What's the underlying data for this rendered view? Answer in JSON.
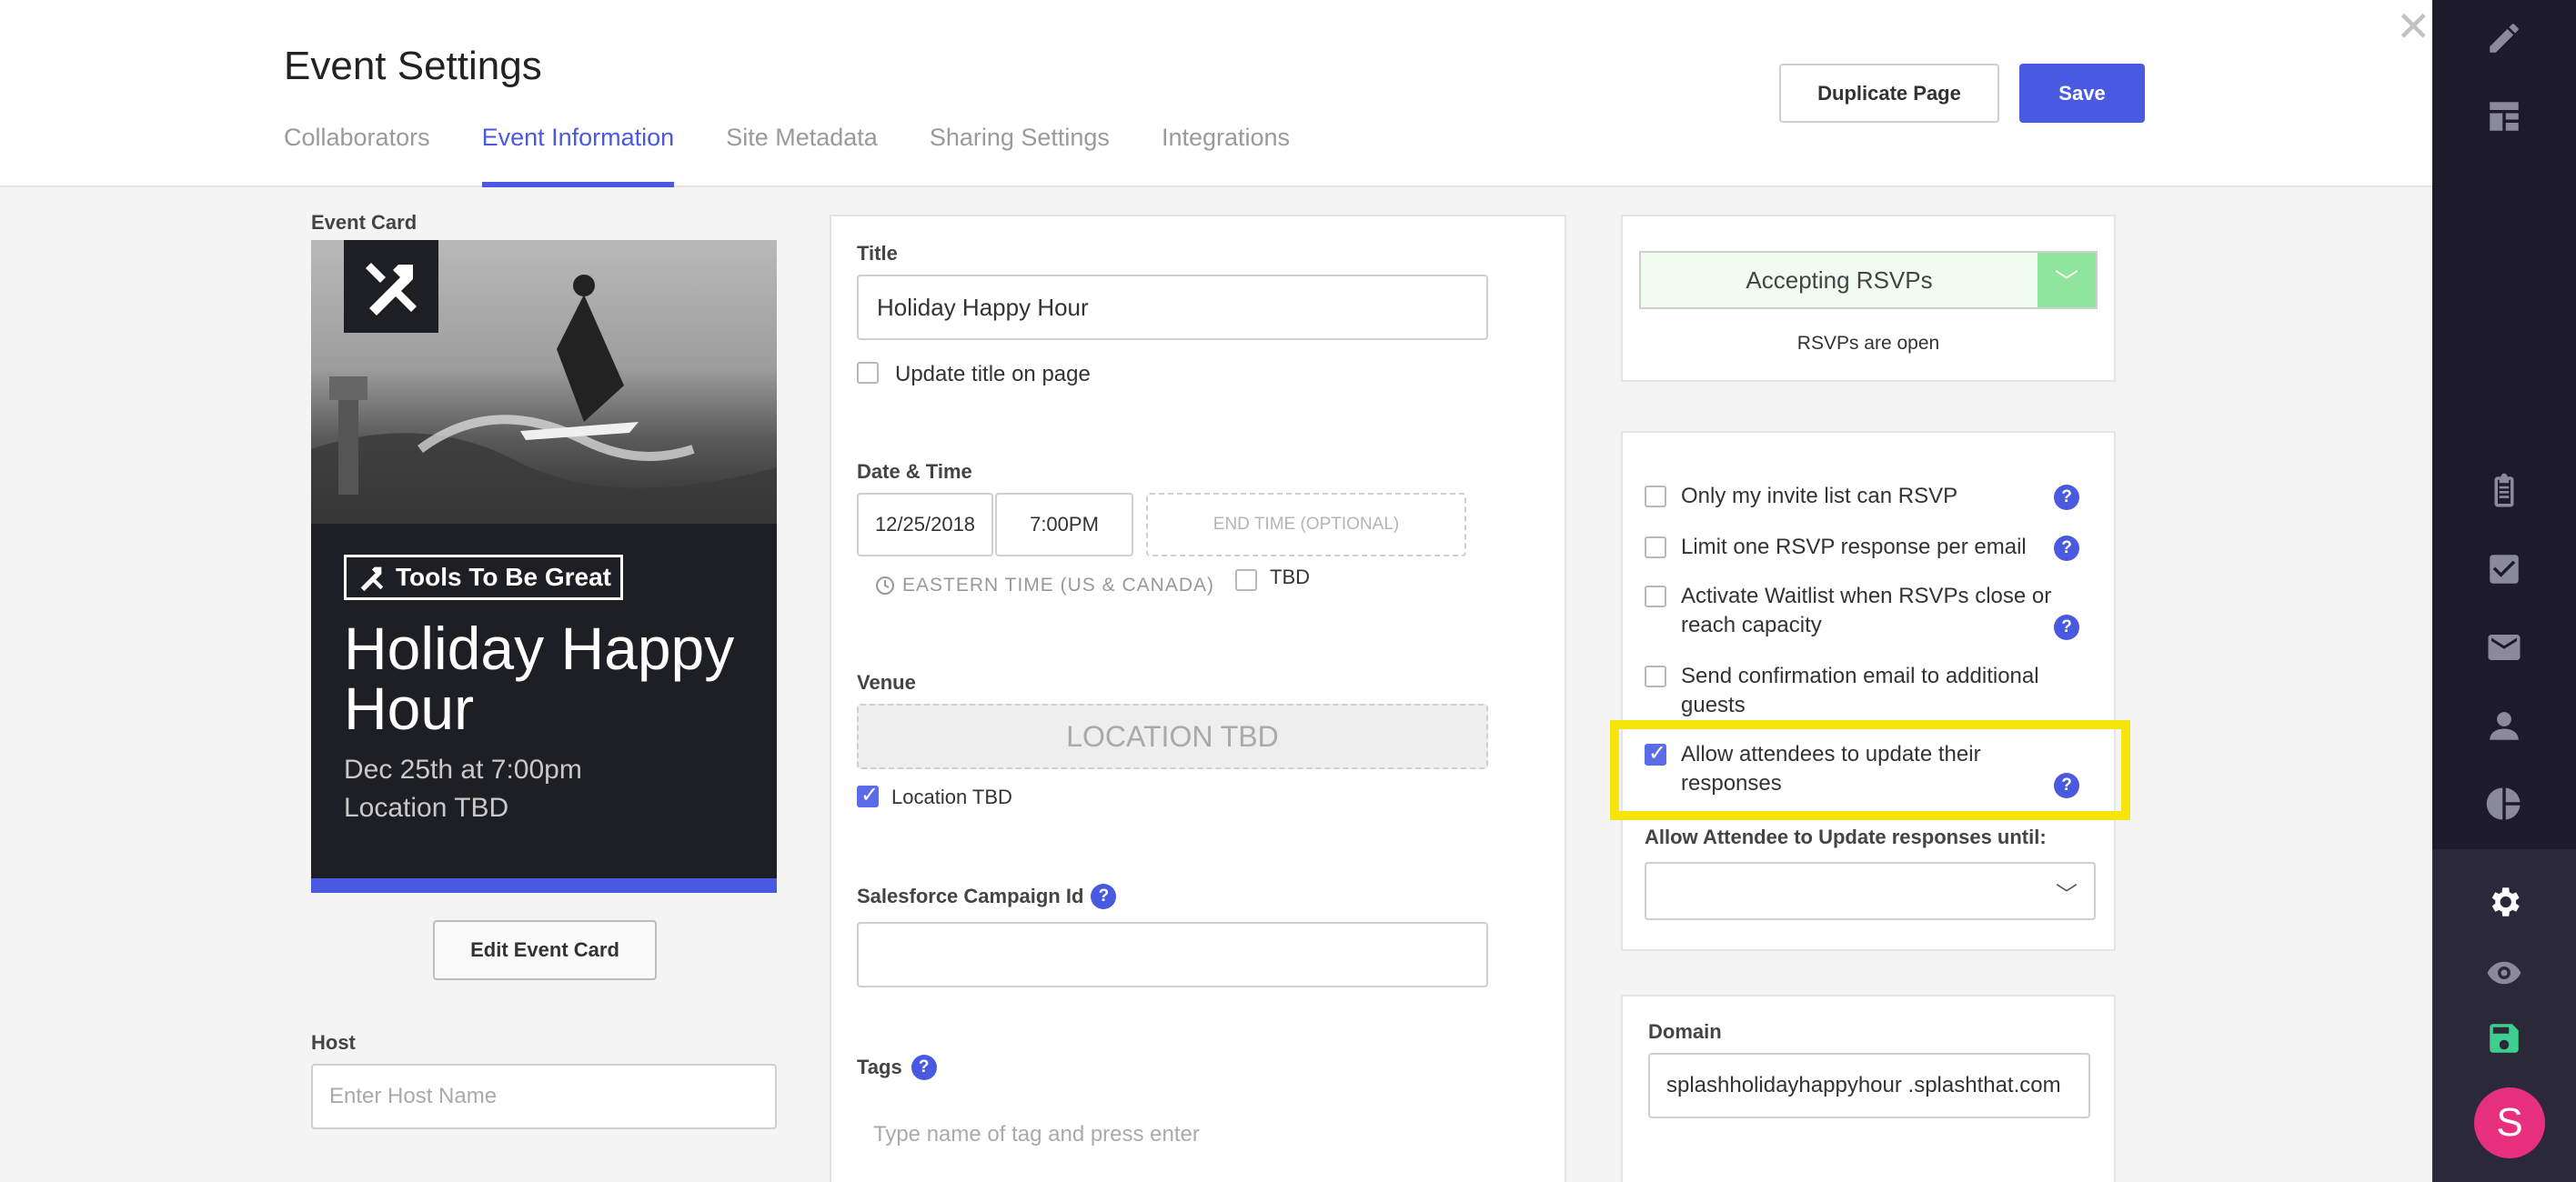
{
  "header": {
    "title": "Event Settings",
    "tabs": [
      {
        "label": "Collaborators"
      },
      {
        "label": "Event Information"
      },
      {
        "label": "Site Metadata"
      },
      {
        "label": "Sharing Settings"
      },
      {
        "label": "Integrations"
      }
    ],
    "active_tab": "Event Information",
    "duplicate_label": "Duplicate Page",
    "save_label": "Save",
    "close_glyph": "✕"
  },
  "event_card": {
    "section_label": "Event Card",
    "brand": "Tools To Be Great",
    "title": "Holiday Happy Hour",
    "date": "Dec 25th at 7:00pm",
    "location": "Location TBD",
    "edit_label": "Edit Event Card"
  },
  "host": {
    "label": "Host",
    "placeholder": "Enter Host Name"
  },
  "title_section": {
    "label": "Title",
    "value": "Holiday Happy Hour",
    "update_checkbox_label": "Update title on page",
    "update_checked": false
  },
  "datetime": {
    "label": "Date & Time",
    "date": "12/25/2018",
    "time": "7:00PM",
    "end_placeholder": "END TIME (OPTIONAL)",
    "timezone": "EASTERN TIME (US & CANADA)",
    "tbd_label": "TBD",
    "tbd_checked": false
  },
  "venue": {
    "label": "Venue",
    "placeholder": "LOCATION TBD",
    "location_tbd_label": "Location TBD",
    "location_tbd_checked": true
  },
  "salesforce": {
    "label": "Salesforce Campaign Id",
    "value": ""
  },
  "tags": {
    "label": "Tags",
    "placeholder": "Type name of tag and press enter"
  },
  "rsvp": {
    "status_select": "Accepting RSVPs",
    "status_text": "RSVPs are open",
    "options": [
      {
        "label": "Only my invite list can RSVP",
        "checked": false,
        "help": true
      },
      {
        "label": "Limit one RSVP response per email",
        "checked": false,
        "help": true
      },
      {
        "label": "Activate Waitlist when RSVPs close or reach capacity",
        "checked": false,
        "help": true
      },
      {
        "label": "Send confirmation email to additional guests",
        "checked": false,
        "help": false
      },
      {
        "label": "Allow attendees to update their responses",
        "checked": true,
        "help": true
      }
    ],
    "until_label": "Allow Attendee to Update responses until:",
    "until_value": ""
  },
  "domain": {
    "label": "Domain",
    "value": "splashholidayhappyhour .splashthat.com"
  },
  "user": {
    "avatar_initial": "S"
  },
  "colors": {
    "accent": "#4a5ae0",
    "sidebar_bg": "#1d1b29",
    "highlight": "#f5e50a",
    "avatar": "#e6307e"
  }
}
